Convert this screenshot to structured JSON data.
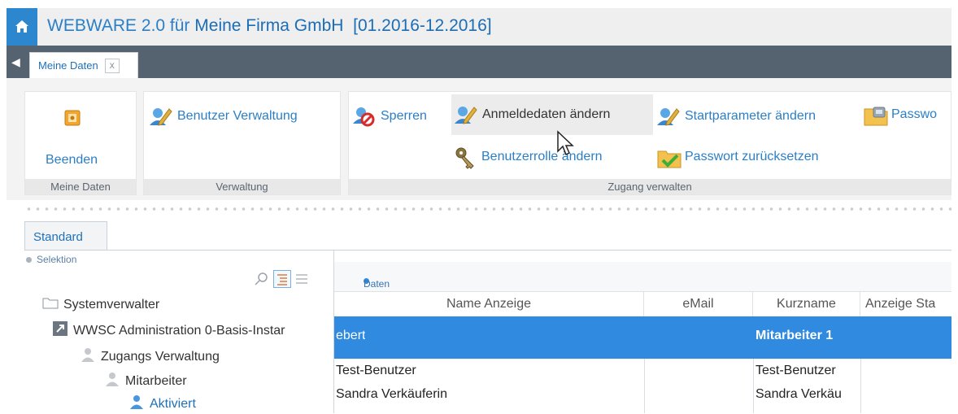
{
  "header": {
    "title_prefix": "WEBWARE 2.0 für ",
    "title_company": "Meine Firma GmbH",
    "title_period": "[01.2016-12.2016]"
  },
  "tabs": [
    {
      "label": "Meine Daten",
      "close": "x"
    }
  ],
  "ribbon": {
    "groups": [
      {
        "label": "Meine Daten",
        "buttons": [
          {
            "label": "Beenden",
            "icon": "exit-icon"
          }
        ]
      },
      {
        "label": "Verwaltung",
        "buttons": [
          {
            "label": "Benutzer Verwaltung",
            "icon": "user-edit-icon"
          }
        ]
      },
      {
        "label": "Zugang verwalten",
        "buttons": [
          {
            "label": "Sperren",
            "icon": "user-block-icon"
          },
          {
            "label": "Anmeldedaten ändern",
            "icon": "user-edit-icon"
          },
          {
            "label": "Startparameter ändern",
            "icon": "user-edit-icon"
          },
          {
            "label": "Passwo",
            "icon": "folder-lock-icon"
          },
          {
            "label": "Benutzerrolle ändern",
            "icon": "keys-icon"
          },
          {
            "label": "Passwort zurücksetzen",
            "icon": "folder-check-icon"
          }
        ]
      }
    ]
  },
  "content_tab": "Standard",
  "selection": {
    "header": "Selektion",
    "tree": [
      {
        "label": "Systemverwalter",
        "icon": "folder-icon"
      },
      {
        "label": "WWSC Administration 0-Basis-Instar",
        "icon": "link-icon"
      },
      {
        "label": "Zugangs Verwaltung",
        "icon": "user-group-icon"
      },
      {
        "label": "Mitarbeiter",
        "icon": "user-icon"
      },
      {
        "label": "Aktiviert",
        "icon": "user-active-icon"
      }
    ]
  },
  "data_panel": {
    "header": "Daten",
    "columns": [
      "Name Anzeige",
      "eMail",
      "Kurzname",
      "Anzeige Sta"
    ],
    "rows": [
      {
        "name": "ebert",
        "email": "",
        "kurz": "Mitarbeiter 1",
        "selected": true
      },
      {
        "name": "Test-Benutzer",
        "email": "",
        "kurz": "Test-Benutzer"
      },
      {
        "name": "Sandra Verkäuferin",
        "email": "",
        "kurz": "Sandra Verkäu"
      }
    ]
  },
  "colors": {
    "accent": "#2d87cf",
    "tabbar": "#55626f",
    "selected_row": "#2f8ae0"
  }
}
